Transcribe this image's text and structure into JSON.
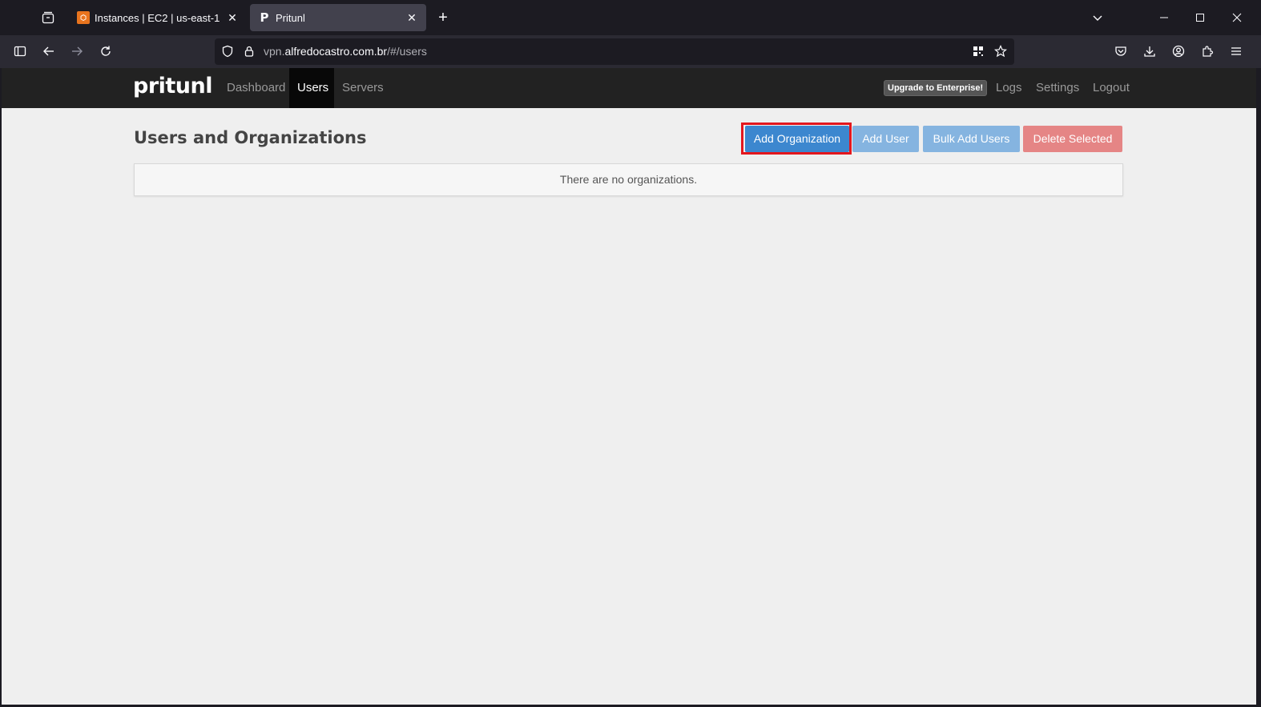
{
  "browser": {
    "tabs": [
      {
        "title": "Instances | EC2 | us-east-1",
        "favicon": "aws-icon",
        "active": false
      },
      {
        "title": "Pritunl",
        "favicon": "pritunl-icon",
        "active": true
      }
    ],
    "url_prefix": "vpn.",
    "url_domain": "alfredocastro.com.br",
    "url_path": "/#/users",
    "new_tab_label": "+"
  },
  "app": {
    "brand": "pritunl",
    "nav": [
      {
        "label": "Dashboard",
        "active": false
      },
      {
        "label": "Users",
        "active": true
      },
      {
        "label": "Servers",
        "active": false
      }
    ],
    "upgrade_label": "Upgrade to Enterprise!",
    "right_nav": [
      {
        "label": "Logs"
      },
      {
        "label": "Settings"
      },
      {
        "label": "Logout"
      }
    ]
  },
  "main": {
    "title": "Users and Organizations",
    "buttons": {
      "add_organization": "Add Organization",
      "add_user": "Add User",
      "bulk_add_users": "Bulk Add Users",
      "delete_selected": "Delete Selected"
    },
    "empty_message": "There are no organizations."
  },
  "colors": {
    "primary": "#3c87cf",
    "primary_light": "#85b4e0",
    "danger_light": "#e58585",
    "highlight": "#e3171e",
    "app_nav_bg": "#222222"
  }
}
